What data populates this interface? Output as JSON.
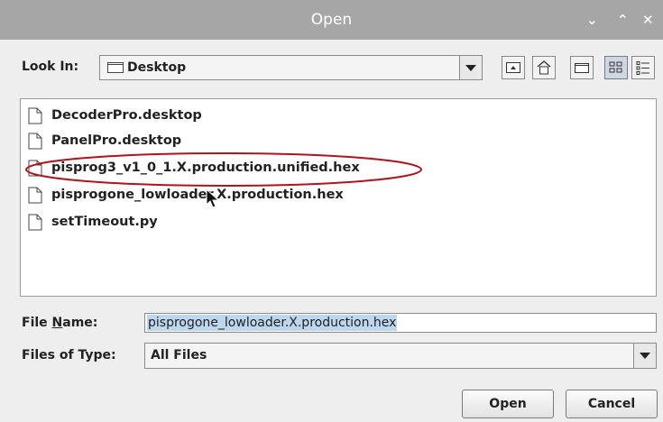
{
  "window": {
    "title": "Open",
    "controls": [
      "minimize-icon",
      "maximize-icon",
      "close-icon"
    ]
  },
  "look_in": {
    "label": "Look In:",
    "value": "Desktop",
    "toolbar_icons": [
      "up-folder-icon",
      "home-icon",
      "new-folder-icon",
      "list-view-icon",
      "details-view-icon"
    ]
  },
  "files": [
    {
      "name": "DecoderPro.desktop"
    },
    {
      "name": "PanelPro.desktop"
    },
    {
      "name": "pisprog3_v1_0_1.X.production.unified.hex"
    },
    {
      "name": "pisprogone_lowloader.X.production.hex"
    },
    {
      "name": "setTimeout.py"
    }
  ],
  "annotation": {
    "color": "#b3121d"
  },
  "file_name": {
    "label": "File Name:",
    "value": "pisprogone_lowloader.X.production.hex"
  },
  "file_type": {
    "label": "Files of Type:",
    "value": "All Files"
  },
  "buttons": {
    "open": "Open",
    "cancel": "Cancel"
  }
}
